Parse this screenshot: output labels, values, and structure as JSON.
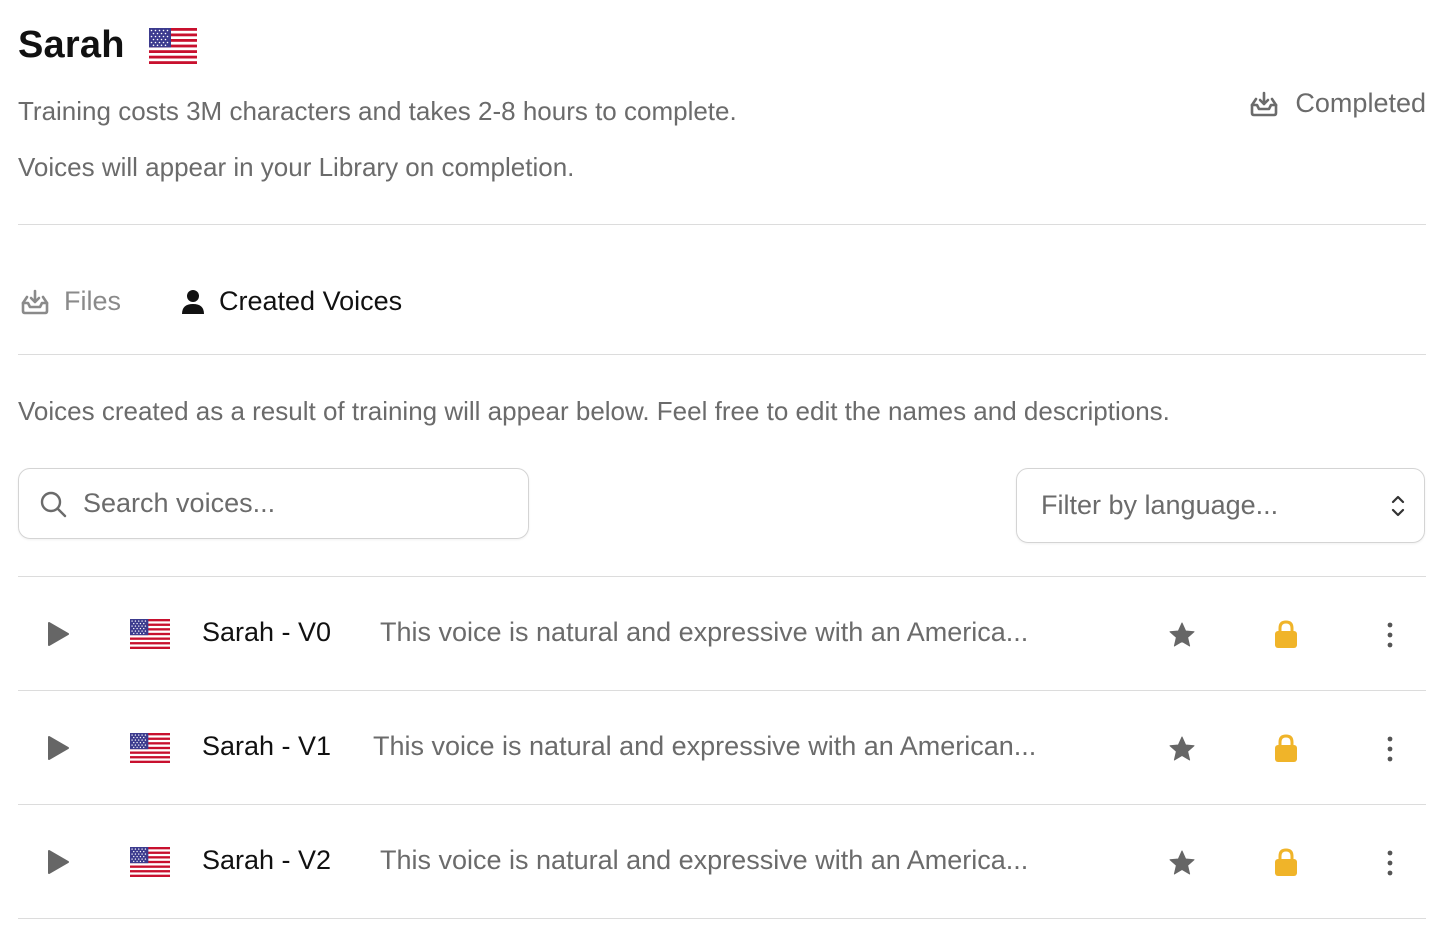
{
  "header": {
    "title": "Sarah",
    "flag": "us-flag-icon",
    "status_label": "Completed",
    "status_icon": "inbox-download-icon",
    "description_line1": "Training costs 3M characters and takes 2-8 hours to complete.",
    "description_line2": "Voices will appear in your Library on completion."
  },
  "tabs": [
    {
      "label": "Files",
      "icon": "inbox-download-icon",
      "active": false
    },
    {
      "label": "Created Voices",
      "icon": "user-icon",
      "active": true
    }
  ],
  "voices_section": {
    "intro": "Voices created as a result of training will appear below. Feel free to edit the names and descriptions.",
    "search_placeholder": "Search voices...",
    "filter_placeholder": "Filter by language..."
  },
  "voices": [
    {
      "name": "Sarah - V0",
      "description": "This voice is natural and expressive with an America..."
    },
    {
      "name": "Sarah - V1",
      "description": "This voice is natural and expressive with an American..."
    },
    {
      "name": "Sarah - V2",
      "description": "This voice is natural and expressive with an America..."
    }
  ],
  "colors": {
    "muted_text": "#6b6b6b",
    "divider": "#dcdcdc",
    "lock": "#f0b429",
    "icon_gray": "#666666"
  }
}
